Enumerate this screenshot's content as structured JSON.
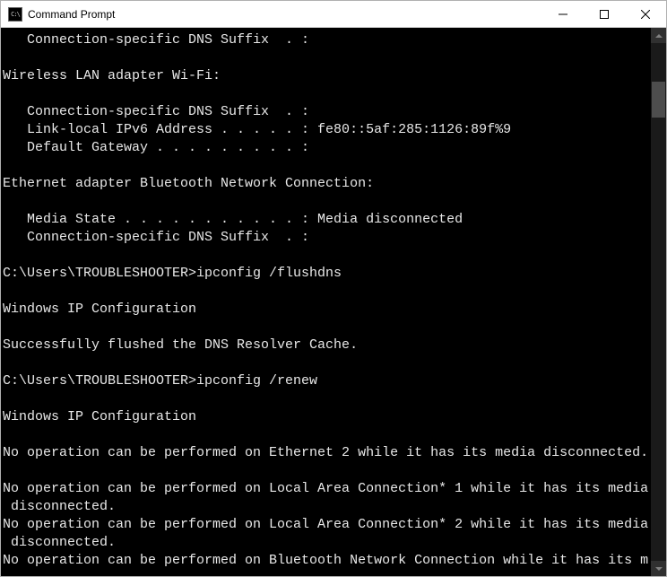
{
  "window": {
    "title": "Command Prompt",
    "icon_text": "C:\\"
  },
  "terminal": {
    "lines": [
      "   Connection-specific DNS Suffix  . :",
      "",
      "Wireless LAN adapter Wi-Fi:",
      "",
      "   Connection-specific DNS Suffix  . :",
      "   Link-local IPv6 Address . . . . . : fe80::5af:285:1126:89f%9",
      "   Default Gateway . . . . . . . . . :",
      "",
      "Ethernet adapter Bluetooth Network Connection:",
      "",
      "   Media State . . . . . . . . . . . : Media disconnected",
      "   Connection-specific DNS Suffix  . :",
      "",
      "C:\\Users\\TROUBLESHOOTER>ipconfig /flushdns",
      "",
      "Windows IP Configuration",
      "",
      "Successfully flushed the DNS Resolver Cache.",
      "",
      "C:\\Users\\TROUBLESHOOTER>ipconfig /renew",
      "",
      "Windows IP Configuration",
      "",
      "No operation can be performed on Ethernet 2 while it has its media disconnected.",
      "",
      "No operation can be performed on Local Area Connection* 1 while it has its media",
      " disconnected.",
      "No operation can be performed on Local Area Connection* 2 while it has its media",
      " disconnected.",
      "No operation can be performed on Bluetooth Network Connection while it has its m"
    ]
  }
}
